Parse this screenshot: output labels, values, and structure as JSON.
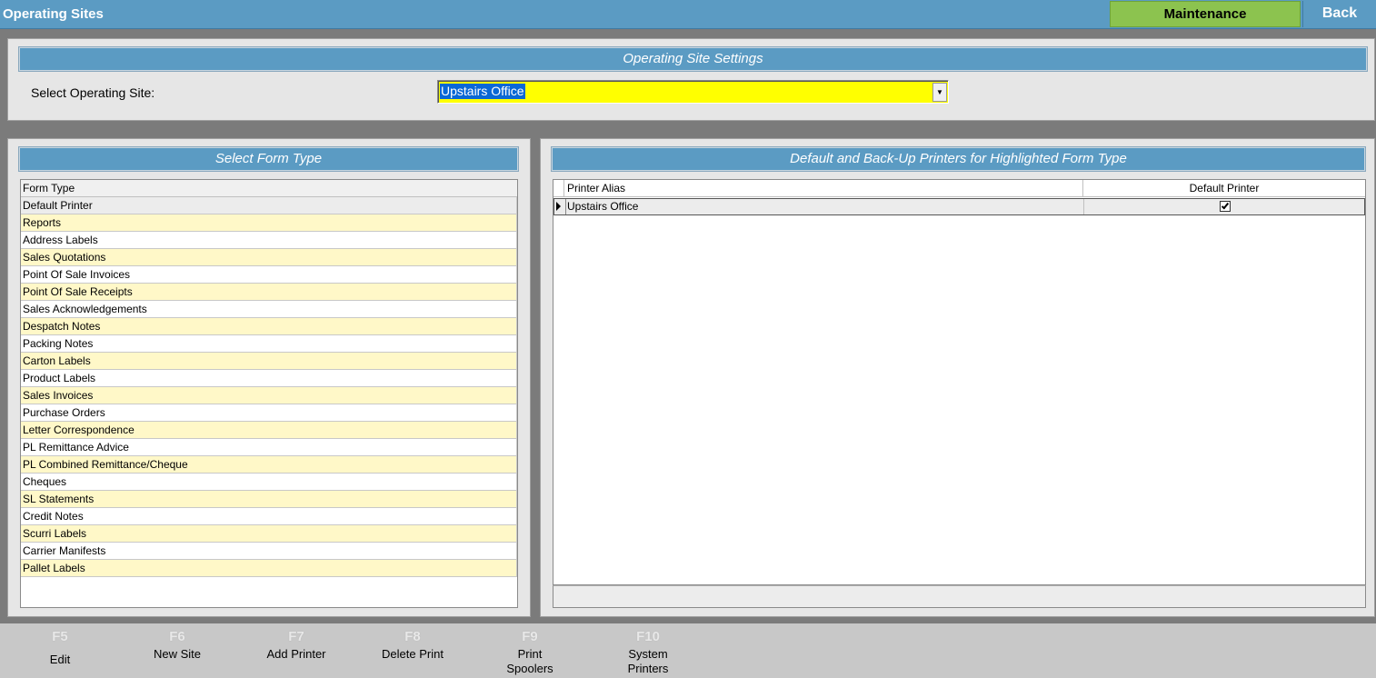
{
  "window": {
    "title": "Operating Sites",
    "maintenance_label": "Maintenance",
    "back_label": "Back"
  },
  "site_settings": {
    "header": "Operating Site Settings",
    "select_label": "Select Operating Site:",
    "selected_value": "Upstairs Office"
  },
  "form_type_panel": {
    "header": "Select Form Type",
    "column_header": "Form Type",
    "selected_index": 0,
    "rows": [
      "Default Printer",
      "Reports",
      "Address Labels",
      "Sales Quotations",
      "Point Of Sale Invoices",
      "Point Of Sale Receipts",
      "Sales Acknowledgements",
      "Despatch Notes",
      "Packing Notes",
      "Carton Labels",
      "Product Labels",
      "Sales Invoices",
      "Purchase Orders",
      "Letter Correspondence",
      "PL Remittance Advice",
      "PL Combined Remittance/Cheque",
      "Cheques",
      "SL Statements",
      "Credit Notes",
      "Scurri Labels",
      "Carrier Manifests",
      "Pallet Labels"
    ]
  },
  "printers_panel": {
    "header": "Default and Back-Up Printers for Highlighted Form Type",
    "columns": {
      "alias": "Printer Alias",
      "default": "Default Printer"
    },
    "rows": [
      {
        "alias": "Upstairs Office",
        "default": true
      }
    ]
  },
  "function_keys": [
    {
      "key": "F5",
      "label": "Edit"
    },
    {
      "key": "F6",
      "label": "New Site"
    },
    {
      "key": "F7",
      "label": "Add Printer"
    },
    {
      "key": "F8",
      "label": "Delete Print"
    },
    {
      "key": "F9",
      "label": "Print Spoolers"
    },
    {
      "key": "F10",
      "label": "System Printers"
    }
  ],
  "colors": {
    "header_blue": "#5b9bc3",
    "maintenance_green": "#8cc34f",
    "select_yellow": "#ffff00",
    "row_alt": "#fff8c8"
  }
}
